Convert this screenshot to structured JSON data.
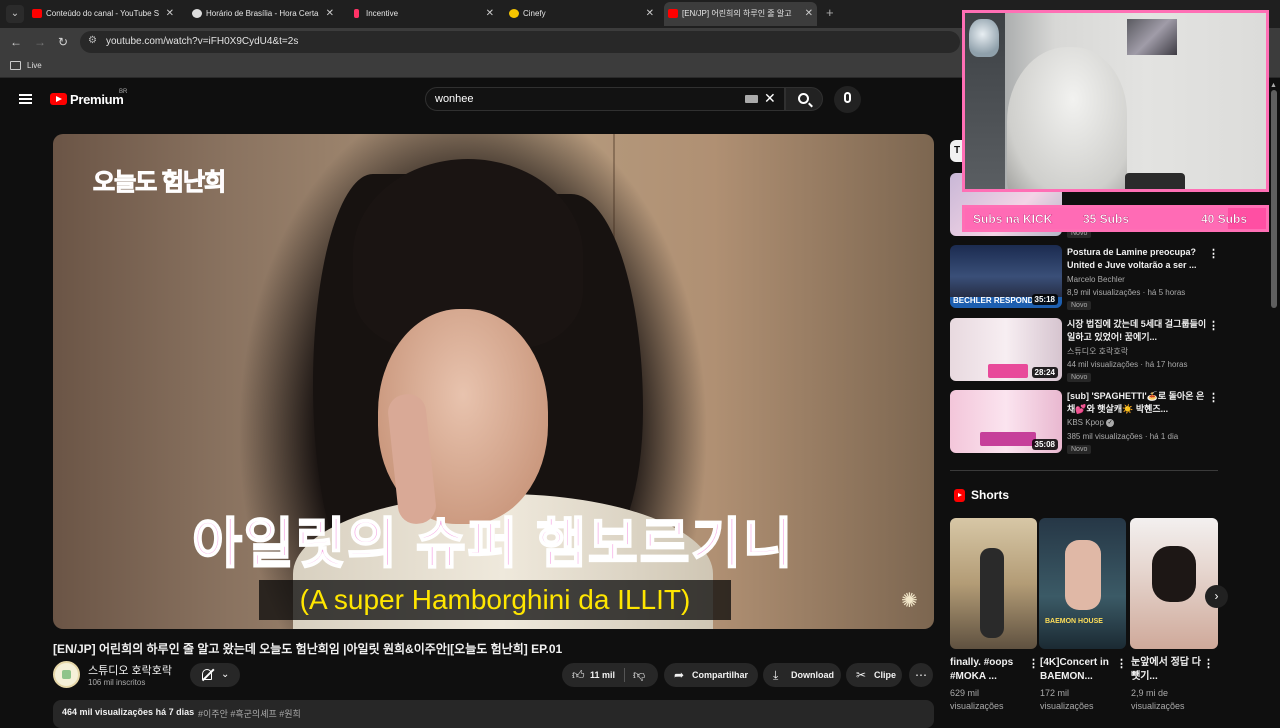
{
  "browser": {
    "tabs": [
      {
        "title": "Conteúdo do canal - YouTube S",
        "favicon_color": "#ff0000"
      },
      {
        "title": "Horário de Brasília - Hora Certa",
        "favicon_color": "#dddddd"
      },
      {
        "title": "Incentive",
        "favicon_color": "#ff3366"
      },
      {
        "title": "Cinefy",
        "favicon_color": "#f7c600"
      },
      {
        "title": "[EN/JP] 어린희의 하루인 줄 알고",
        "favicon_color": "#ff0000"
      }
    ],
    "url": "youtube.com/watch?v=iFH0X9CydU4&t=2s",
    "bookmark": "Live"
  },
  "youtube": {
    "brand": "Premium",
    "country": "BR",
    "search_query": "wonhee"
  },
  "video": {
    "overlay_logo": "오늘도 험난희",
    "subtitle_ko": "아일릿의 슈퍼 햄보르기니",
    "subtitle_pt": "(A super Hamborghini da ILLIT)",
    "title": "[EN/JP] 어린희의 하루인 줄 알고 왔는데 오늘도 험난희임 |아일릿 원희&이주안|[오늘도 험난희] EP.01",
    "channel": "스튜디오 호락호락",
    "subscribers": "106 mil inscritos",
    "likes": "11 mil",
    "share_label": "Compartilhar",
    "download_label": "Download",
    "clip_label": "Clipe",
    "views": "464 mil visualizações",
    "age": "há 7 dias",
    "tags": "#이주안 #흑군의셰프 #원희"
  },
  "sidebar": {
    "partial_chip": "T",
    "videos": [
      {
        "title": "Postura de Lamine preocupa? United e Juve voltarão a ser ...",
        "channel": "Marcelo Bechler",
        "meta": "8,9 mil visualizações · há 5 horas",
        "badge": "Novo",
        "duration": "35:18",
        "thumb_text": "BECHLER RESPONDE"
      },
      {
        "title": "시장 법집에 갔는데 5세대 걸그룹들이 일하고 있었어! 꿈에기...",
        "channel": "스튜디오 호락호락",
        "meta": "44 mil visualizações · há 17 horas",
        "badge": "Novo",
        "duration": "28:24"
      },
      {
        "title": "[sub] 'SPAGHETTI'🍝로 돌아온 은채💕와 햇살캐☀️ 박혠즈...",
        "channel": "KBS Kpop",
        "meta": "385 mil visualizações · há 1 dia",
        "badge": "Novo",
        "duration": "35:08"
      }
    ],
    "first_badge": "Novo",
    "shorts_heading": "Shorts",
    "shorts": [
      {
        "title": "finally. #oops #MOKA ...",
        "views": "629 mil visualizações"
      },
      {
        "title": "[4K]Concert in BAEMON...",
        "views": "172 mil visualizações",
        "thumb_text": "BAEMON HOUSE"
      },
      {
        "title": "눈앞에서 정답 다 뺏기...",
        "views": "2,9 mi de visualizações"
      }
    ]
  },
  "stream_overlay": {
    "goal_fill_fraction": 0.875,
    "goals": [
      "Subs na KICK",
      "35 Subs",
      "40 Subs"
    ],
    "accent": "#ff6fb5"
  }
}
